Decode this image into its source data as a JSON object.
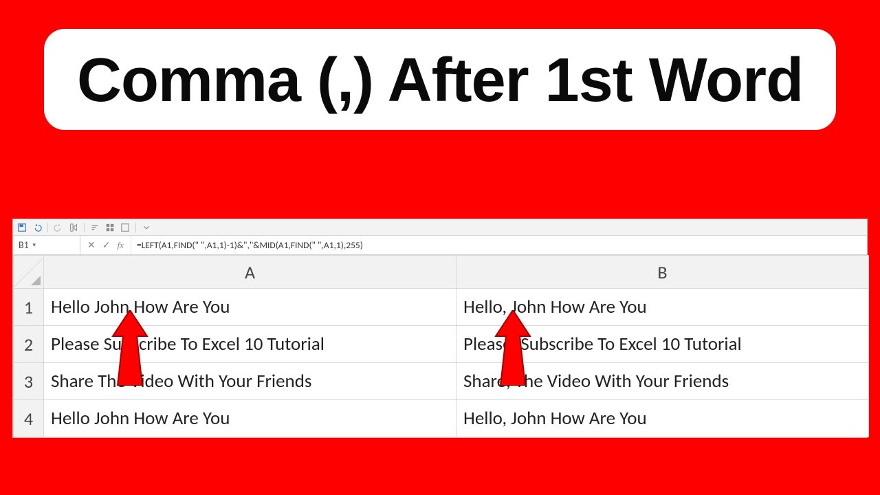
{
  "title": "Comma (,) After 1st Word",
  "toolbar": {
    "name_box": "B1",
    "formula": "=LEFT(A1,FIND(\" \",A1,1)-1)&\",\"&MID(A1,FIND(\" \",A1,1),255)"
  },
  "columns": {
    "a": "A",
    "b": "B"
  },
  "rows": [
    {
      "n": "1",
      "a": "Hello John How Are You",
      "b": "Hello, John How Are You"
    },
    {
      "n": "2",
      "a": "Please Subscribe To Excel 10 Tutorial",
      "b": "Please, Subscribe To Excel 10 Tutorial"
    },
    {
      "n": "3",
      "a": "Share The Video With Your Friends",
      "b": "Share, The Video With Your Friends"
    },
    {
      "n": "4",
      "a": "Hello John How Are You",
      "b": "Hello, John How Are You"
    }
  ]
}
